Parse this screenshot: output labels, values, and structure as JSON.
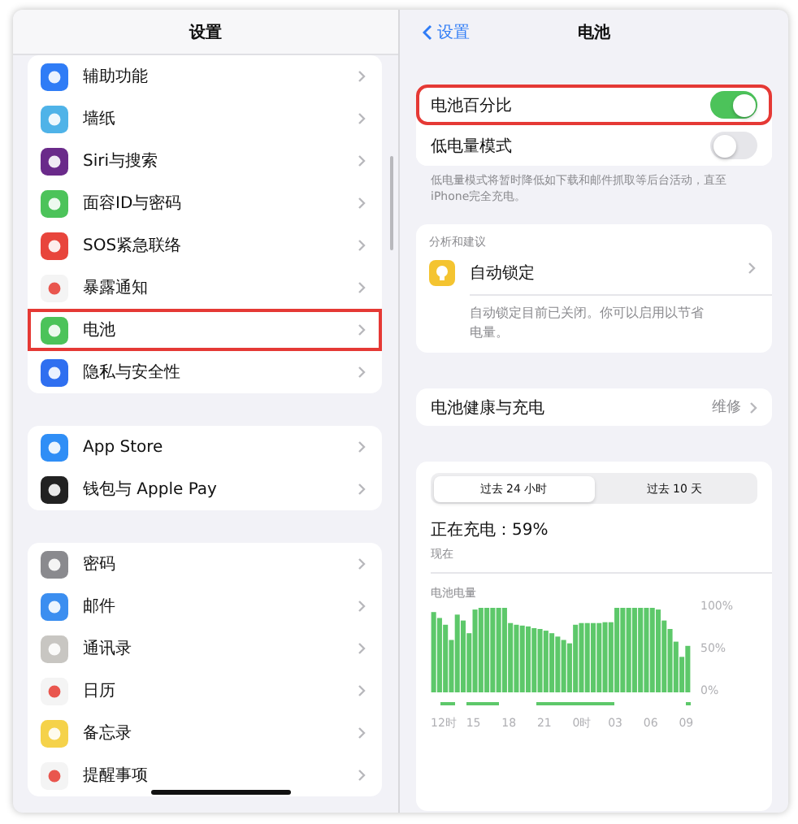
{
  "sidebar": {
    "title": "设置",
    "groups": [
      {
        "items": [
          {
            "label": "辅助功能",
            "color": "#2f7cf6",
            "highlighted": false
          },
          {
            "label": "墙纸",
            "color": "#4fb3e8",
            "highlighted": false
          },
          {
            "label": "Siri与搜索",
            "color": "#6a2a8a",
            "highlighted": false
          },
          {
            "label": "面容ID与密码",
            "color": "#4cc35a",
            "highlighted": false
          },
          {
            "label": "SOS紧急联络",
            "color": "#e8453c",
            "highlighted": false
          },
          {
            "label": "暴露通知",
            "color": "#f4f4f4",
            "highlighted": false
          },
          {
            "label": "电池",
            "color": "#4cc35a",
            "highlighted": true
          },
          {
            "label": "隐私与安全性",
            "color": "#2f6ff0",
            "highlighted": false
          }
        ]
      },
      {
        "items": [
          {
            "label": "App Store",
            "color": "#2f8ef6",
            "highlighted": false
          },
          {
            "label": "钱包与 Apple Pay",
            "color": "#222222",
            "highlighted": false
          }
        ]
      },
      {
        "items": [
          {
            "label": "密码",
            "color": "#8a8a8e",
            "highlighted": false
          },
          {
            "label": "邮件",
            "color": "#3b8ef0",
            "highlighted": false
          },
          {
            "label": "通讯录",
            "color": "#c8c6c2",
            "highlighted": false
          },
          {
            "label": "日历",
            "color": "#f4f4f4",
            "highlighted": false
          },
          {
            "label": "备忘录",
            "color": "#f5d24a",
            "highlighted": false
          },
          {
            "label": "提醒事项",
            "color": "#f4f4f4",
            "highlighted": false
          }
        ]
      }
    ]
  },
  "detail": {
    "back": "设置",
    "title": "电池",
    "toggles": [
      {
        "label": "电池百分比",
        "on": true,
        "highlighted": true
      },
      {
        "label": "低电量模式",
        "on": false,
        "highlighted": false
      }
    ],
    "toggle_note": "低电量模式将暂时降低如下载和邮件抓取等后台活动，直至iPhone完全充电。",
    "insights": {
      "header": "分析和建议",
      "title": "自动锁定",
      "note": "自动锁定目前已关闭。你可以启用以节省电量。"
    },
    "health": {
      "label": "电池健康与充电",
      "value": "维修"
    },
    "usage": {
      "tabs": [
        {
          "label": "过去 24 小时",
          "selected": true
        },
        {
          "label": "过去 10 天",
          "selected": false
        }
      ],
      "status": "正在充电：59%",
      "time": "现在",
      "chart_data": {
        "type": "bar",
        "title": "电池电量",
        "color": "#5dc86a",
        "values": [
          95,
          88,
          80,
          62,
          92,
          85,
          70,
          98,
          100,
          100,
          100,
          100,
          100,
          82,
          80,
          79,
          78,
          76,
          75,
          73,
          70,
          66,
          62,
          58,
          80,
          82,
          82,
          82,
          82,
          83,
          83,
          100,
          100,
          100,
          100,
          100,
          100,
          100,
          98,
          85,
          75,
          60,
          42,
          55
        ],
        "ylim": [
          0,
          100
        ],
        "yticks": [
          {
            "value": 100,
            "label": "100%"
          },
          {
            "value": 50,
            "label": "50%"
          },
          {
            "value": 0,
            "label": "0%"
          }
        ]
      },
      "time_labels": [
        "12时",
        "15",
        "18",
        "21",
        "0时",
        "03",
        "06",
        "09"
      ]
    }
  }
}
